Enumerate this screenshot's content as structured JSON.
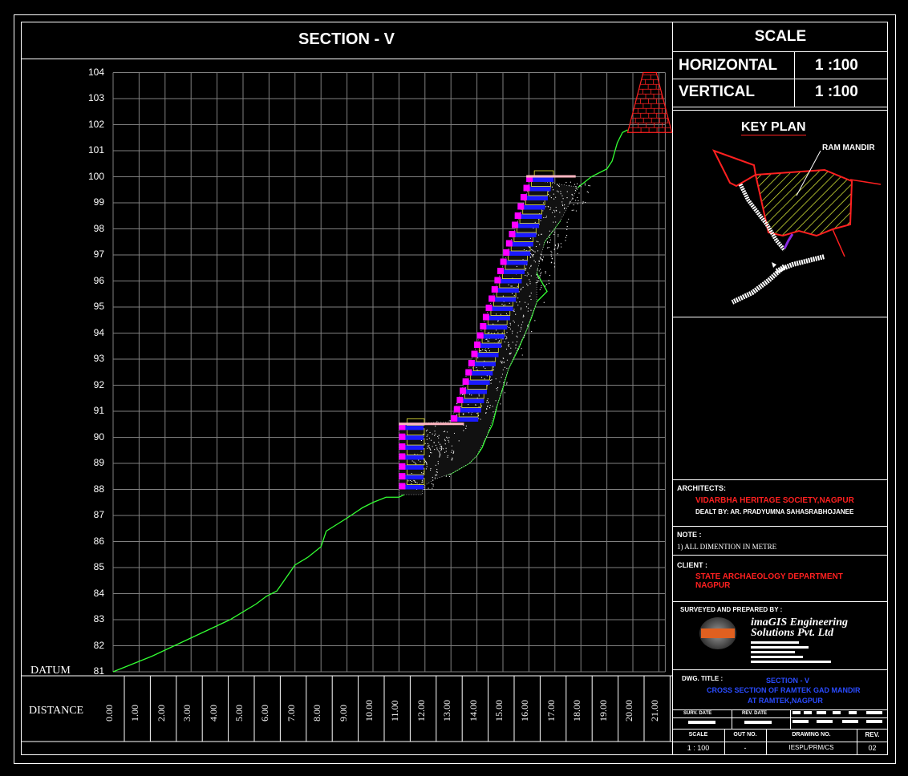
{
  "drawing": {
    "title": "SECTION - V",
    "datum_label": "DATUM",
    "distance_label": "DISTANCE",
    "y_ticks": [
      "81",
      "82",
      "83",
      "84",
      "85",
      "86",
      "87",
      "88",
      "89",
      "90",
      "91",
      "92",
      "93",
      "94",
      "95",
      "96",
      "97",
      "98",
      "99",
      "100",
      "101",
      "102",
      "103",
      "104"
    ],
    "x_ticks": [
      "0.00",
      "1.00",
      "2.00",
      "3.00",
      "4.00",
      "5.00",
      "6.00",
      "7.00",
      "8.00",
      "9.00",
      "10.00",
      "11.00",
      "12.00",
      "13.00",
      "14.00",
      "15.00",
      "16.00",
      "17.00",
      "18.00",
      "19.00",
      "20.00",
      "21.00"
    ],
    "colors": {
      "ground": "#33ff33",
      "steps_blue": "#1a1aff",
      "steps_magenta": "#ff00ff",
      "tower": "#ff2020",
      "grid": "#808080"
    }
  },
  "scale_panel": {
    "heading": "SCALE",
    "horizontal_label": "HORIZONTAL",
    "horizontal_value": "1 :100",
    "vertical_label": "VERTICAL",
    "vertical_value": "1 :100"
  },
  "key_plan": {
    "title": "KEY PLAN",
    "marker_label": "RAM MANDIR"
  },
  "architects": {
    "label": "ARCHITECTS:",
    "name": "VIDARBHA HERITAGE SOCIETY,NAGPUR",
    "dealt_by": "DEALT BY: AR. PRADYUMNA SAHASRABHOJANEE"
  },
  "note": {
    "label": "NOTE :",
    "text": "1) ALL DIMENTION IN METRE"
  },
  "client": {
    "label": "CLIENT :",
    "line1": "STATE ARCHAEOLOGY DEPARTMENT",
    "line2": "NAGPUR"
  },
  "surveyed": {
    "label": "SURVEYED AND PREPARED BY :",
    "company_line1": "imaGIS Engineering",
    "company_line2": "Solutions Pvt. Ltd"
  },
  "dwg_title": {
    "label": "DWG. TITLE :",
    "line1": "SECTION - V",
    "line2": "CROSS SECTION OF RAMTEK GAD MANDIR",
    "line3": "AT RAMTEK,NAGPUR"
  },
  "dates": {
    "surv_date": "SURV. DATE",
    "rev_date": "REV. DATE"
  },
  "footer": {
    "scale_label": "SCALE",
    "scale_value": "1 : 100",
    "out_no_label": "OUT NO.",
    "out_no_value": "-",
    "drawing_no_label": "DRAWING NO.",
    "drawing_no_value": "IESPL/PRM/CS",
    "rev_label": "REV.",
    "rev_value": "02"
  }
}
